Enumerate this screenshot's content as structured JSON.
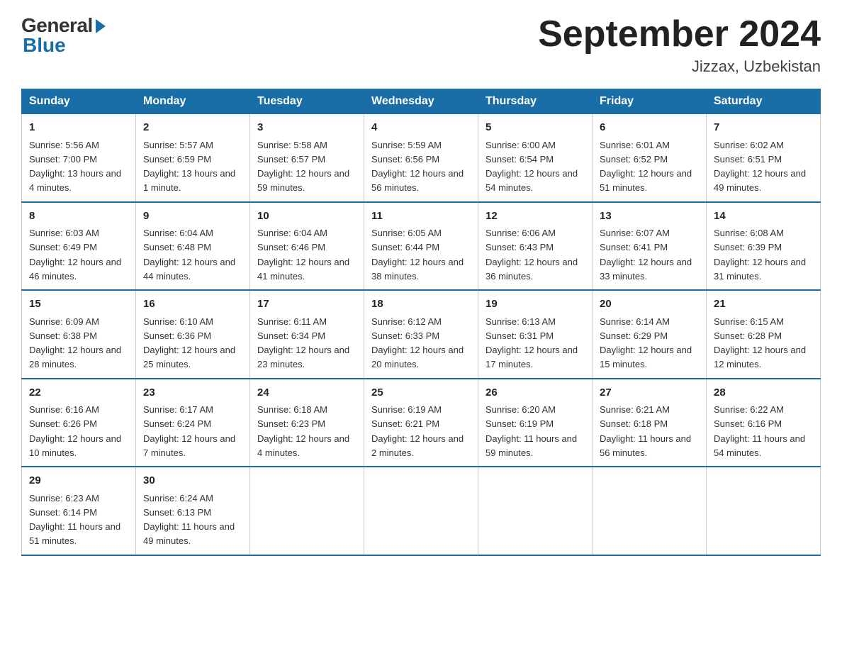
{
  "header": {
    "logo_general": "General",
    "logo_blue": "Blue",
    "month_title": "September 2024",
    "location": "Jizzax, Uzbekistan"
  },
  "days_of_week": [
    "Sunday",
    "Monday",
    "Tuesday",
    "Wednesday",
    "Thursday",
    "Friday",
    "Saturday"
  ],
  "weeks": [
    [
      {
        "date": "1",
        "sunrise": "5:56 AM",
        "sunset": "7:00 PM",
        "daylight": "13 hours and 4 minutes."
      },
      {
        "date": "2",
        "sunrise": "5:57 AM",
        "sunset": "6:59 PM",
        "daylight": "13 hours and 1 minute."
      },
      {
        "date": "3",
        "sunrise": "5:58 AM",
        "sunset": "6:57 PM",
        "daylight": "12 hours and 59 minutes."
      },
      {
        "date": "4",
        "sunrise": "5:59 AM",
        "sunset": "6:56 PM",
        "daylight": "12 hours and 56 minutes."
      },
      {
        "date": "5",
        "sunrise": "6:00 AM",
        "sunset": "6:54 PM",
        "daylight": "12 hours and 54 minutes."
      },
      {
        "date": "6",
        "sunrise": "6:01 AM",
        "sunset": "6:52 PM",
        "daylight": "12 hours and 51 minutes."
      },
      {
        "date": "7",
        "sunrise": "6:02 AM",
        "sunset": "6:51 PM",
        "daylight": "12 hours and 49 minutes."
      }
    ],
    [
      {
        "date": "8",
        "sunrise": "6:03 AM",
        "sunset": "6:49 PM",
        "daylight": "12 hours and 46 minutes."
      },
      {
        "date": "9",
        "sunrise": "6:04 AM",
        "sunset": "6:48 PM",
        "daylight": "12 hours and 44 minutes."
      },
      {
        "date": "10",
        "sunrise": "6:04 AM",
        "sunset": "6:46 PM",
        "daylight": "12 hours and 41 minutes."
      },
      {
        "date": "11",
        "sunrise": "6:05 AM",
        "sunset": "6:44 PM",
        "daylight": "12 hours and 38 minutes."
      },
      {
        "date": "12",
        "sunrise": "6:06 AM",
        "sunset": "6:43 PM",
        "daylight": "12 hours and 36 minutes."
      },
      {
        "date": "13",
        "sunrise": "6:07 AM",
        "sunset": "6:41 PM",
        "daylight": "12 hours and 33 minutes."
      },
      {
        "date": "14",
        "sunrise": "6:08 AM",
        "sunset": "6:39 PM",
        "daylight": "12 hours and 31 minutes."
      }
    ],
    [
      {
        "date": "15",
        "sunrise": "6:09 AM",
        "sunset": "6:38 PM",
        "daylight": "12 hours and 28 minutes."
      },
      {
        "date": "16",
        "sunrise": "6:10 AM",
        "sunset": "6:36 PM",
        "daylight": "12 hours and 25 minutes."
      },
      {
        "date": "17",
        "sunrise": "6:11 AM",
        "sunset": "6:34 PM",
        "daylight": "12 hours and 23 minutes."
      },
      {
        "date": "18",
        "sunrise": "6:12 AM",
        "sunset": "6:33 PM",
        "daylight": "12 hours and 20 minutes."
      },
      {
        "date": "19",
        "sunrise": "6:13 AM",
        "sunset": "6:31 PM",
        "daylight": "12 hours and 17 minutes."
      },
      {
        "date": "20",
        "sunrise": "6:14 AM",
        "sunset": "6:29 PM",
        "daylight": "12 hours and 15 minutes."
      },
      {
        "date": "21",
        "sunrise": "6:15 AM",
        "sunset": "6:28 PM",
        "daylight": "12 hours and 12 minutes."
      }
    ],
    [
      {
        "date": "22",
        "sunrise": "6:16 AM",
        "sunset": "6:26 PM",
        "daylight": "12 hours and 10 minutes."
      },
      {
        "date": "23",
        "sunrise": "6:17 AM",
        "sunset": "6:24 PM",
        "daylight": "12 hours and 7 minutes."
      },
      {
        "date": "24",
        "sunrise": "6:18 AM",
        "sunset": "6:23 PM",
        "daylight": "12 hours and 4 minutes."
      },
      {
        "date": "25",
        "sunrise": "6:19 AM",
        "sunset": "6:21 PM",
        "daylight": "12 hours and 2 minutes."
      },
      {
        "date": "26",
        "sunrise": "6:20 AM",
        "sunset": "6:19 PM",
        "daylight": "11 hours and 59 minutes."
      },
      {
        "date": "27",
        "sunrise": "6:21 AM",
        "sunset": "6:18 PM",
        "daylight": "11 hours and 56 minutes."
      },
      {
        "date": "28",
        "sunrise": "6:22 AM",
        "sunset": "6:16 PM",
        "daylight": "11 hours and 54 minutes."
      }
    ],
    [
      {
        "date": "29",
        "sunrise": "6:23 AM",
        "sunset": "6:14 PM",
        "daylight": "11 hours and 51 minutes."
      },
      {
        "date": "30",
        "sunrise": "6:24 AM",
        "sunset": "6:13 PM",
        "daylight": "11 hours and 49 minutes."
      },
      null,
      null,
      null,
      null,
      null
    ]
  ]
}
